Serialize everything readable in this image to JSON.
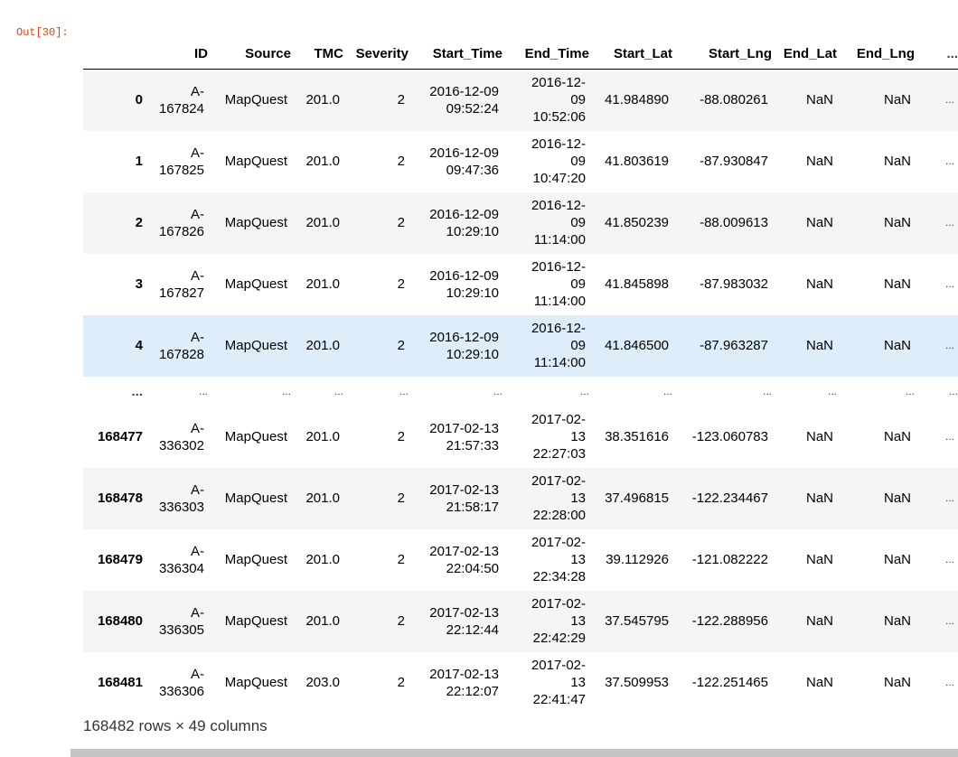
{
  "prompt": "Out[30]:",
  "columns": [
    "ID",
    "Source",
    "TMC",
    "Severity",
    "Start_Time",
    "End_Time",
    "Start_Lat",
    "Start_Lng",
    "End_Lat",
    "End_Lng",
    "..."
  ],
  "rows": [
    {
      "index": "0",
      "id": [
        "A-",
        "167824"
      ],
      "source": "MapQuest",
      "tmc": "201.0",
      "severity": "2",
      "start_time": [
        "2016-12-09",
        "09:52:24"
      ],
      "end_time": [
        "2016-12-",
        "09",
        "10:52:06"
      ],
      "start_lat": "41.984890",
      "start_lng": "-88.080261",
      "end_lat": "NaN",
      "end_lng": "NaN",
      "more": "..."
    },
    {
      "index": "1",
      "id": [
        "A-",
        "167825"
      ],
      "source": "MapQuest",
      "tmc": "201.0",
      "severity": "2",
      "start_time": [
        "2016-12-09",
        "09:47:36"
      ],
      "end_time": [
        "2016-12-",
        "09",
        "10:47:20"
      ],
      "start_lat": "41.803619",
      "start_lng": "-87.930847",
      "end_lat": "NaN",
      "end_lng": "NaN",
      "more": "..."
    },
    {
      "index": "2",
      "id": [
        "A-",
        "167826"
      ],
      "source": "MapQuest",
      "tmc": "201.0",
      "severity": "2",
      "start_time": [
        "2016-12-09",
        "10:29:10"
      ],
      "end_time": [
        "2016-12-",
        "09",
        "11:14:00"
      ],
      "start_lat": "41.850239",
      "start_lng": "-88.009613",
      "end_lat": "NaN",
      "end_lng": "NaN",
      "more": "..."
    },
    {
      "index": "3",
      "id": [
        "A-",
        "167827"
      ],
      "source": "MapQuest",
      "tmc": "201.0",
      "severity": "2",
      "start_time": [
        "2016-12-09",
        "10:29:10"
      ],
      "end_time": [
        "2016-12-",
        "09",
        "11:14:00"
      ],
      "start_lat": "41.845898",
      "start_lng": "-87.983032",
      "end_lat": "NaN",
      "end_lng": "NaN",
      "more": "..."
    },
    {
      "index": "4",
      "id": [
        "A-",
        "167828"
      ],
      "source": "MapQuest",
      "tmc": "201.0",
      "severity": "2",
      "start_time": [
        "2016-12-09",
        "10:29:10"
      ],
      "end_time": [
        "2016-12-",
        "09",
        "11:14:00"
      ],
      "start_lat": "41.846500",
      "start_lng": "-87.963287",
      "end_lat": "NaN",
      "end_lng": "NaN",
      "more": "..."
    },
    {
      "index": "...",
      "ellipsis": true,
      "cells": [
        "...",
        "...",
        "...",
        "...",
        "...",
        "...",
        "...",
        "...",
        "...",
        "...",
        "..."
      ]
    },
    {
      "index": "168477",
      "id": [
        "A-",
        "336302"
      ],
      "source": "MapQuest",
      "tmc": "201.0",
      "severity": "2",
      "start_time": [
        "2017-02-13",
        "21:57:33"
      ],
      "end_time": [
        "2017-02-",
        "13",
        "22:27:03"
      ],
      "start_lat": "38.351616",
      "start_lng": "-123.060783",
      "end_lat": "NaN",
      "end_lng": "NaN",
      "more": "..."
    },
    {
      "index": "168478",
      "id": [
        "A-",
        "336303"
      ],
      "source": "MapQuest",
      "tmc": "201.0",
      "severity": "2",
      "start_time": [
        "2017-02-13",
        "21:58:17"
      ],
      "end_time": [
        "2017-02-",
        "13",
        "22:28:00"
      ],
      "start_lat": "37.496815",
      "start_lng": "-122.234467",
      "end_lat": "NaN",
      "end_lng": "NaN",
      "more": "..."
    },
    {
      "index": "168479",
      "id": [
        "A-",
        "336304"
      ],
      "source": "MapQuest",
      "tmc": "201.0",
      "severity": "2",
      "start_time": [
        "2017-02-13",
        "22:04:50"
      ],
      "end_time": [
        "2017-02-",
        "13",
        "22:34:28"
      ],
      "start_lat": "39.112926",
      "start_lng": "-121.082222",
      "end_lat": "NaN",
      "end_lng": "NaN",
      "more": "..."
    },
    {
      "index": "168480",
      "id": [
        "A-",
        "336305"
      ],
      "source": "MapQuest",
      "tmc": "201.0",
      "severity": "2",
      "start_time": [
        "2017-02-13",
        "22:12:44"
      ],
      "end_time": [
        "2017-02-",
        "13",
        "22:42:29"
      ],
      "start_lat": "37.545795",
      "start_lng": "-122.288956",
      "end_lat": "NaN",
      "end_lng": "NaN",
      "more": "..."
    },
    {
      "index": "168481",
      "id": [
        "A-",
        "336306"
      ],
      "source": "MapQuest",
      "tmc": "203.0",
      "severity": "2",
      "start_time": [
        "2017-02-13",
        "22:12:07"
      ],
      "end_time": [
        "2017-02-",
        "13",
        "22:41:47"
      ],
      "start_lat": "37.509953",
      "start_lng": "-122.251465",
      "end_lat": "NaN",
      "end_lng": "NaN",
      "more": "..."
    }
  ],
  "footer": "168482 rows × 49 columns",
  "colors": {
    "prompt": "#d84315",
    "row_striped": "#f5f5f5",
    "row_hover": "#ddeefa",
    "scrollbar": "#c4c4c4"
  }
}
